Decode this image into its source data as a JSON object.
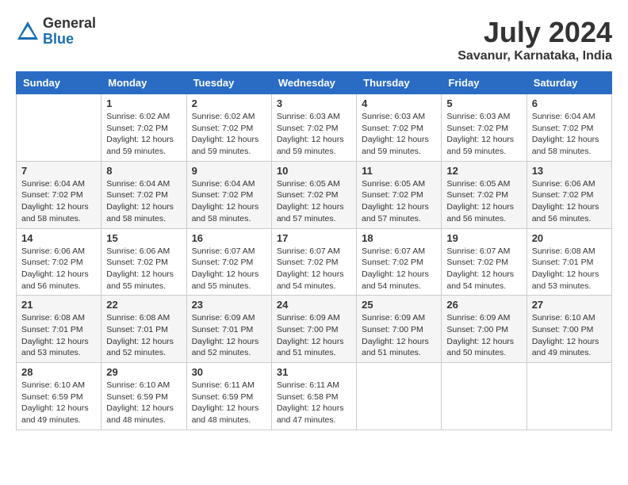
{
  "header": {
    "logo_general": "General",
    "logo_blue": "Blue",
    "month_year": "July 2024",
    "location": "Savanur, Karnataka, India"
  },
  "calendar": {
    "days_of_week": [
      "Sunday",
      "Monday",
      "Tuesday",
      "Wednesday",
      "Thursday",
      "Friday",
      "Saturday"
    ],
    "weeks": [
      [
        {
          "day": "",
          "empty": true
        },
        {
          "day": "1",
          "sunrise": "Sunrise: 6:02 AM",
          "sunset": "Sunset: 7:02 PM",
          "daylight": "Daylight: 12 hours and 59 minutes."
        },
        {
          "day": "2",
          "sunrise": "Sunrise: 6:02 AM",
          "sunset": "Sunset: 7:02 PM",
          "daylight": "Daylight: 12 hours and 59 minutes."
        },
        {
          "day": "3",
          "sunrise": "Sunrise: 6:03 AM",
          "sunset": "Sunset: 7:02 PM",
          "daylight": "Daylight: 12 hours and 59 minutes."
        },
        {
          "day": "4",
          "sunrise": "Sunrise: 6:03 AM",
          "sunset": "Sunset: 7:02 PM",
          "daylight": "Daylight: 12 hours and 59 minutes."
        },
        {
          "day": "5",
          "sunrise": "Sunrise: 6:03 AM",
          "sunset": "Sunset: 7:02 PM",
          "daylight": "Daylight: 12 hours and 59 minutes."
        },
        {
          "day": "6",
          "sunrise": "Sunrise: 6:04 AM",
          "sunset": "Sunset: 7:02 PM",
          "daylight": "Daylight: 12 hours and 58 minutes."
        }
      ],
      [
        {
          "day": "7",
          "sunrise": "Sunrise: 6:04 AM",
          "sunset": "Sunset: 7:02 PM",
          "daylight": "Daylight: 12 hours and 58 minutes."
        },
        {
          "day": "8",
          "sunrise": "Sunrise: 6:04 AM",
          "sunset": "Sunset: 7:02 PM",
          "daylight": "Daylight: 12 hours and 58 minutes."
        },
        {
          "day": "9",
          "sunrise": "Sunrise: 6:04 AM",
          "sunset": "Sunset: 7:02 PM",
          "daylight": "Daylight: 12 hours and 58 minutes."
        },
        {
          "day": "10",
          "sunrise": "Sunrise: 6:05 AM",
          "sunset": "Sunset: 7:02 PM",
          "daylight": "Daylight: 12 hours and 57 minutes."
        },
        {
          "day": "11",
          "sunrise": "Sunrise: 6:05 AM",
          "sunset": "Sunset: 7:02 PM",
          "daylight": "Daylight: 12 hours and 57 minutes."
        },
        {
          "day": "12",
          "sunrise": "Sunrise: 6:05 AM",
          "sunset": "Sunset: 7:02 PM",
          "daylight": "Daylight: 12 hours and 56 minutes."
        },
        {
          "day": "13",
          "sunrise": "Sunrise: 6:06 AM",
          "sunset": "Sunset: 7:02 PM",
          "daylight": "Daylight: 12 hours and 56 minutes."
        }
      ],
      [
        {
          "day": "14",
          "sunrise": "Sunrise: 6:06 AM",
          "sunset": "Sunset: 7:02 PM",
          "daylight": "Daylight: 12 hours and 56 minutes."
        },
        {
          "day": "15",
          "sunrise": "Sunrise: 6:06 AM",
          "sunset": "Sunset: 7:02 PM",
          "daylight": "Daylight: 12 hours and 55 minutes."
        },
        {
          "day": "16",
          "sunrise": "Sunrise: 6:07 AM",
          "sunset": "Sunset: 7:02 PM",
          "daylight": "Daylight: 12 hours and 55 minutes."
        },
        {
          "day": "17",
          "sunrise": "Sunrise: 6:07 AM",
          "sunset": "Sunset: 7:02 PM",
          "daylight": "Daylight: 12 hours and 54 minutes."
        },
        {
          "day": "18",
          "sunrise": "Sunrise: 6:07 AM",
          "sunset": "Sunset: 7:02 PM",
          "daylight": "Daylight: 12 hours and 54 minutes."
        },
        {
          "day": "19",
          "sunrise": "Sunrise: 6:07 AM",
          "sunset": "Sunset: 7:02 PM",
          "daylight": "Daylight: 12 hours and 54 minutes."
        },
        {
          "day": "20",
          "sunrise": "Sunrise: 6:08 AM",
          "sunset": "Sunset: 7:01 PM",
          "daylight": "Daylight: 12 hours and 53 minutes."
        }
      ],
      [
        {
          "day": "21",
          "sunrise": "Sunrise: 6:08 AM",
          "sunset": "Sunset: 7:01 PM",
          "daylight": "Daylight: 12 hours and 53 minutes."
        },
        {
          "day": "22",
          "sunrise": "Sunrise: 6:08 AM",
          "sunset": "Sunset: 7:01 PM",
          "daylight": "Daylight: 12 hours and 52 minutes."
        },
        {
          "day": "23",
          "sunrise": "Sunrise: 6:09 AM",
          "sunset": "Sunset: 7:01 PM",
          "daylight": "Daylight: 12 hours and 52 minutes."
        },
        {
          "day": "24",
          "sunrise": "Sunrise: 6:09 AM",
          "sunset": "Sunset: 7:00 PM",
          "daylight": "Daylight: 12 hours and 51 minutes."
        },
        {
          "day": "25",
          "sunrise": "Sunrise: 6:09 AM",
          "sunset": "Sunset: 7:00 PM",
          "daylight": "Daylight: 12 hours and 51 minutes."
        },
        {
          "day": "26",
          "sunrise": "Sunrise: 6:09 AM",
          "sunset": "Sunset: 7:00 PM",
          "daylight": "Daylight: 12 hours and 50 minutes."
        },
        {
          "day": "27",
          "sunrise": "Sunrise: 6:10 AM",
          "sunset": "Sunset: 7:00 PM",
          "daylight": "Daylight: 12 hours and 49 minutes."
        }
      ],
      [
        {
          "day": "28",
          "sunrise": "Sunrise: 6:10 AM",
          "sunset": "Sunset: 6:59 PM",
          "daylight": "Daylight: 12 hours and 49 minutes."
        },
        {
          "day": "29",
          "sunrise": "Sunrise: 6:10 AM",
          "sunset": "Sunset: 6:59 PM",
          "daylight": "Daylight: 12 hours and 48 minutes."
        },
        {
          "day": "30",
          "sunrise": "Sunrise: 6:11 AM",
          "sunset": "Sunset: 6:59 PM",
          "daylight": "Daylight: 12 hours and 48 minutes."
        },
        {
          "day": "31",
          "sunrise": "Sunrise: 6:11 AM",
          "sunset": "Sunset: 6:58 PM",
          "daylight": "Daylight: 12 hours and 47 minutes."
        },
        {
          "day": "",
          "empty": true
        },
        {
          "day": "",
          "empty": true
        },
        {
          "day": "",
          "empty": true
        }
      ]
    ]
  }
}
